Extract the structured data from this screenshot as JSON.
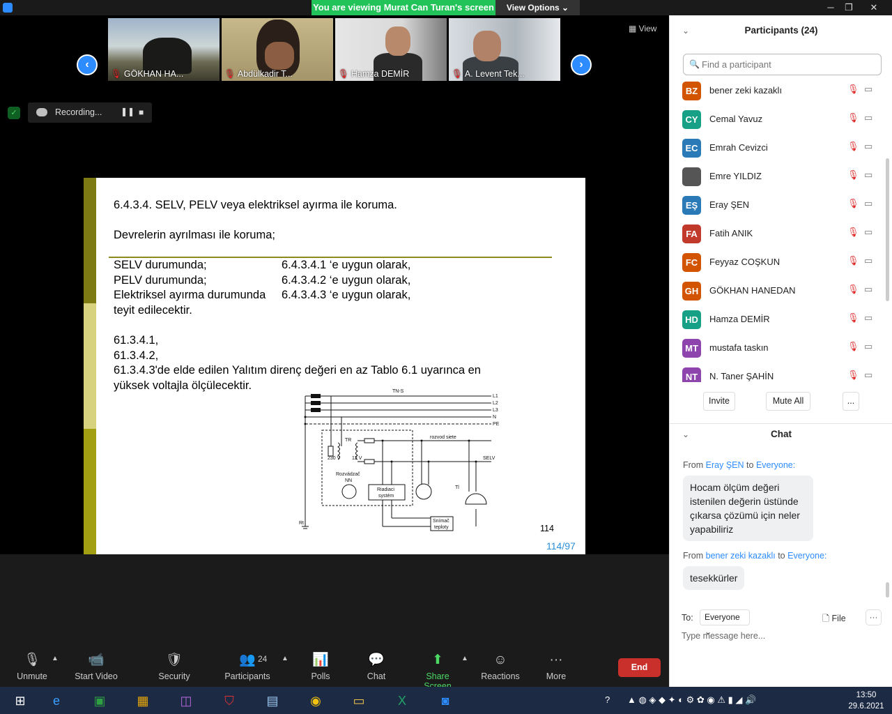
{
  "banner": {
    "viewing_text": "You are viewing Murat Can Turan's screen",
    "view_options": "View Options ⌄"
  },
  "window": {
    "minimize": "─",
    "restore": "❐",
    "close": "✕"
  },
  "videos": {
    "prev": "‹",
    "next": "›",
    "view_label": "▦ View",
    "tiles": [
      {
        "name": "GÖKHAN HA..."
      },
      {
        "name": "Abdülkadir T..."
      },
      {
        "name": "Hamza DEMİR"
      },
      {
        "name": "A. Levent Tek..."
      }
    ],
    "mic_off_glyph": "🎙"
  },
  "recording": {
    "label": "Recording...",
    "pause": "❚❚",
    "stop": "■"
  },
  "slide": {
    "heading": "6.4.3.4. SELV, PELV veya elektriksel ayırma ile koruma.",
    "subheading": "Devrelerin ayrılması ile koruma;",
    "rows": [
      {
        "left": "SELV durumunda;",
        "right": "6.4.3.4.1 ‘e uygun olarak,"
      },
      {
        "left": "PELV durumunda;",
        "right": "6.4.3.4.2 ‘e uygun olarak,"
      },
      {
        "left": "Elektriksel ayırma durumunda",
        "right": "6.4.3.4.3 ‘e uygun olarak,"
      }
    ],
    "confirm": "teyit edilecektir.",
    "refs": [
      "61.3.4.1,",
      "61.3.4.2,",
      "61.3.4.3'de elde edilen Yalıtım direnç değeri en az Tablo 6.1 uyarınca en",
      "yüksek voltajla ölçülecektir."
    ],
    "diagram": {
      "title": "TN-S",
      "lines": [
        "L1",
        "L2",
        "L3",
        "N",
        "PE"
      ],
      "labels": {
        "rozvod": "rozvod siete",
        "selv": "SELV",
        "tr": "TR",
        "v230": "230 V",
        "v12": "12 V",
        "rozvadzac": "Rozvádzač",
        "nn": "NN",
        "riadiaci1": "Riadiaci",
        "riadiaci2": "systém",
        "tl": "Tl",
        "snimac1": "Snímač",
        "snimac2": "teploty",
        "rt": "Rt"
      }
    },
    "page_number": "114",
    "slide_counter": "114/97"
  },
  "toolbar": {
    "unmute": "Unmute",
    "start_video": "Start Video",
    "security": "Security",
    "participants": "Participants",
    "participants_count": "24",
    "polls": "Polls",
    "chat": "Chat",
    "share_screen": "Share Screen",
    "reactions": "Reactions",
    "more": "More",
    "end": "End"
  },
  "participants_panel": {
    "title": "Participants (24)",
    "search_placeholder": "Find a participant",
    "list": [
      {
        "initials": "BZ",
        "name": "bener zeki kazaklı",
        "color": "#d35400"
      },
      {
        "initials": "CY",
        "name": "Cemal Yavuz",
        "color": "#16a085"
      },
      {
        "initials": "EC",
        "name": "Emrah Cevizci",
        "color": "#2a7ab8"
      },
      {
        "initials": "",
        "name": "Emre YILDIZ",
        "color": "#555555"
      },
      {
        "initials": "EŞ",
        "name": "Eray ŞEN",
        "color": "#2a7ab8"
      },
      {
        "initials": "FA",
        "name": "Fatih ANIK",
        "color": "#c0392b"
      },
      {
        "initials": "FC",
        "name": "Feyyaz COŞKUN",
        "color": "#d35400"
      },
      {
        "initials": "GH",
        "name": "GÖKHAN HANEDAN",
        "color": "#d35400"
      },
      {
        "initials": "HD",
        "name": "Hamza DEMİR",
        "color": "#16a085"
      },
      {
        "initials": "MT",
        "name": "mustafa taskın",
        "color": "#8e44ad"
      },
      {
        "initials": "NT",
        "name": "N. Taner ŞAHİN",
        "color": "#8e44ad"
      }
    ],
    "invite": "Invite",
    "mute_all": "Mute All",
    "more": "..."
  },
  "chat_panel": {
    "title": "Chat",
    "messages": [
      {
        "from_prefix": "From",
        "sender": "Eray ŞEN",
        "to_word": "to",
        "recipient": "Everyone:",
        "lines": [
          "Hocam ölçüm değeri",
          "istenilen değerin üstünde",
          "çıkarsa çözümü için neler",
          "yapabiliriz"
        ]
      },
      {
        "from_prefix": "From",
        "sender": "bener zeki kazaklı",
        "to_word": "to",
        "recipient": "Everyone:",
        "lines": [
          "tesekkürler"
        ]
      }
    ],
    "to_label": "To:",
    "to_value": "Everyone ⌄",
    "file": "File",
    "more": "···",
    "input_placeholder": "Type message here..."
  },
  "taskbar": {
    "time": "13:50",
    "date": "29.6.2021"
  }
}
